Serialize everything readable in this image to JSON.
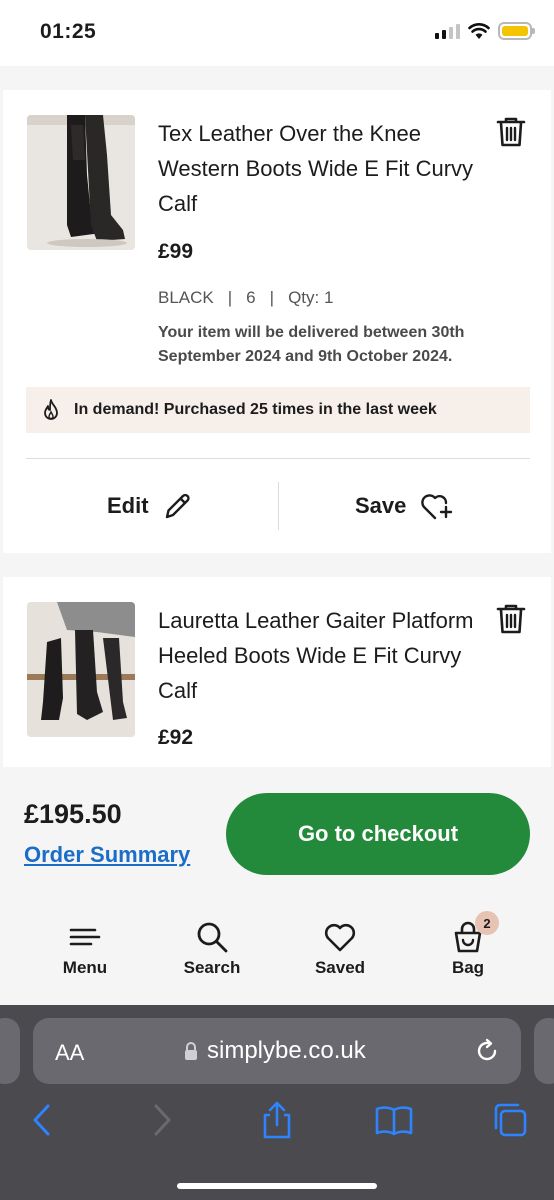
{
  "status_bar": {
    "time": "01:25"
  },
  "items": [
    {
      "name": "Tex Leather Over the Knee Western Boots Wide E Fit Curvy Calf",
      "price": "£99",
      "colour": "BLACK",
      "size": "6",
      "qty": "Qty: 1",
      "delivery": "Your item will be delivered between 30th September 2024 and 9th October 2024.",
      "demand": "In demand! Purchased 25 times in the last week",
      "edit_label": "Edit",
      "save_label": "Save"
    },
    {
      "name": "Lauretta Leather Gaiter Platform Heeled Boots Wide E Fit Curvy Calf",
      "price": "£92"
    }
  ],
  "checkout": {
    "total": "£195.50",
    "order_summary": "Order Summary",
    "button": "Go to checkout",
    "button_color": "#238a3c"
  },
  "nav": {
    "menu": "Menu",
    "search": "Search",
    "saved": "Saved",
    "bag": "Bag",
    "bag_count": "2"
  },
  "browser": {
    "text_size": "AA",
    "url": "simplybe.co.uk"
  },
  "meta_separator": "|"
}
